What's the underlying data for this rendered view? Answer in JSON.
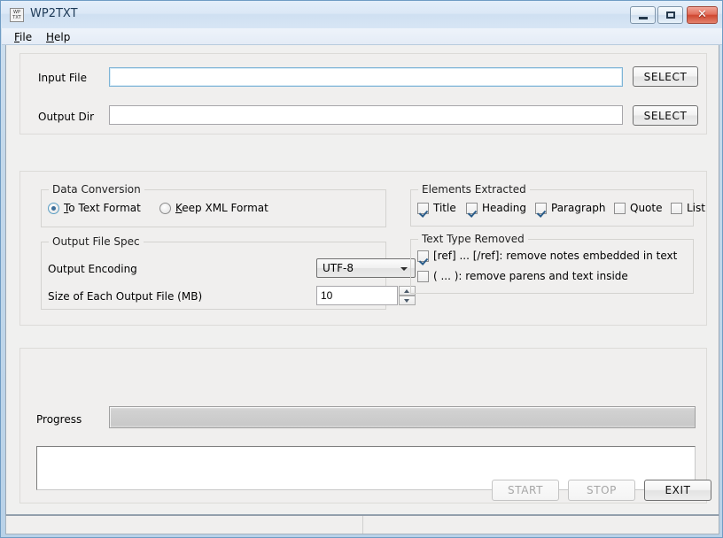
{
  "window": {
    "title": "WP2TXT",
    "icon_line1": "WP",
    "icon_line2": "TXT",
    "controls": {
      "minimize": "minimize-button",
      "maximize": "maximize-button",
      "close_glyph": "✕"
    }
  },
  "menubar": {
    "items": [
      {
        "label": "File",
        "mnemonic": "F",
        "rest": "ile"
      },
      {
        "label": "Help",
        "mnemonic": "H",
        "rest": "elp"
      }
    ]
  },
  "files": {
    "input_file": {
      "label": "Input File",
      "value": "",
      "placeholder": "",
      "button": "SELECT"
    },
    "output_dir": {
      "label": "Output Dir",
      "value": "",
      "placeholder": "",
      "button": "SELECT"
    }
  },
  "data_conversion": {
    "title": "Data Conversion",
    "options": [
      {
        "label": "To Text Format",
        "mnemonic": "T",
        "rest": "o Text Format",
        "selected": true
      },
      {
        "label": "Keep XML Format",
        "mnemonic": "K",
        "rest": "eep XML Format",
        "selected": false
      }
    ]
  },
  "output_file_spec": {
    "title": "Output File Spec",
    "encoding_label": "Output Encoding",
    "encoding_value": "UTF-8",
    "size_label": "Size of Each Output File (MB)",
    "size_value": "10"
  },
  "elements_extracted": {
    "title": "Elements Extracted",
    "items": [
      {
        "label": "Title",
        "checked": true
      },
      {
        "label": "Heading",
        "checked": true
      },
      {
        "label": "Paragraph",
        "checked": true
      },
      {
        "label": "Quote",
        "checked": false
      },
      {
        "label": "List",
        "checked": false
      }
    ]
  },
  "text_type_removed": {
    "title": "Text Type Removed",
    "items": [
      {
        "label": "[ref] ... [/ref]: remove notes embedded in text",
        "checked": true
      },
      {
        "label": "( ... ): remove parens and text inside",
        "checked": false
      }
    ]
  },
  "progress": {
    "label": "Progress",
    "percent": 0,
    "log_text": ""
  },
  "actions": {
    "start": {
      "label": "START",
      "enabled": false
    },
    "stop": {
      "label": "STOP",
      "enabled": false
    },
    "exit": {
      "label": "EXIT",
      "enabled": true
    }
  },
  "statusbar": {
    "pane1": "",
    "pane2": ""
  },
  "colors": {
    "window_frame": "#b9d2e8",
    "client_bg": "#f0f0ef",
    "panel_bg": "#f0efee",
    "close_button": "#cf4730",
    "focus_border": "#7eb4d6"
  }
}
